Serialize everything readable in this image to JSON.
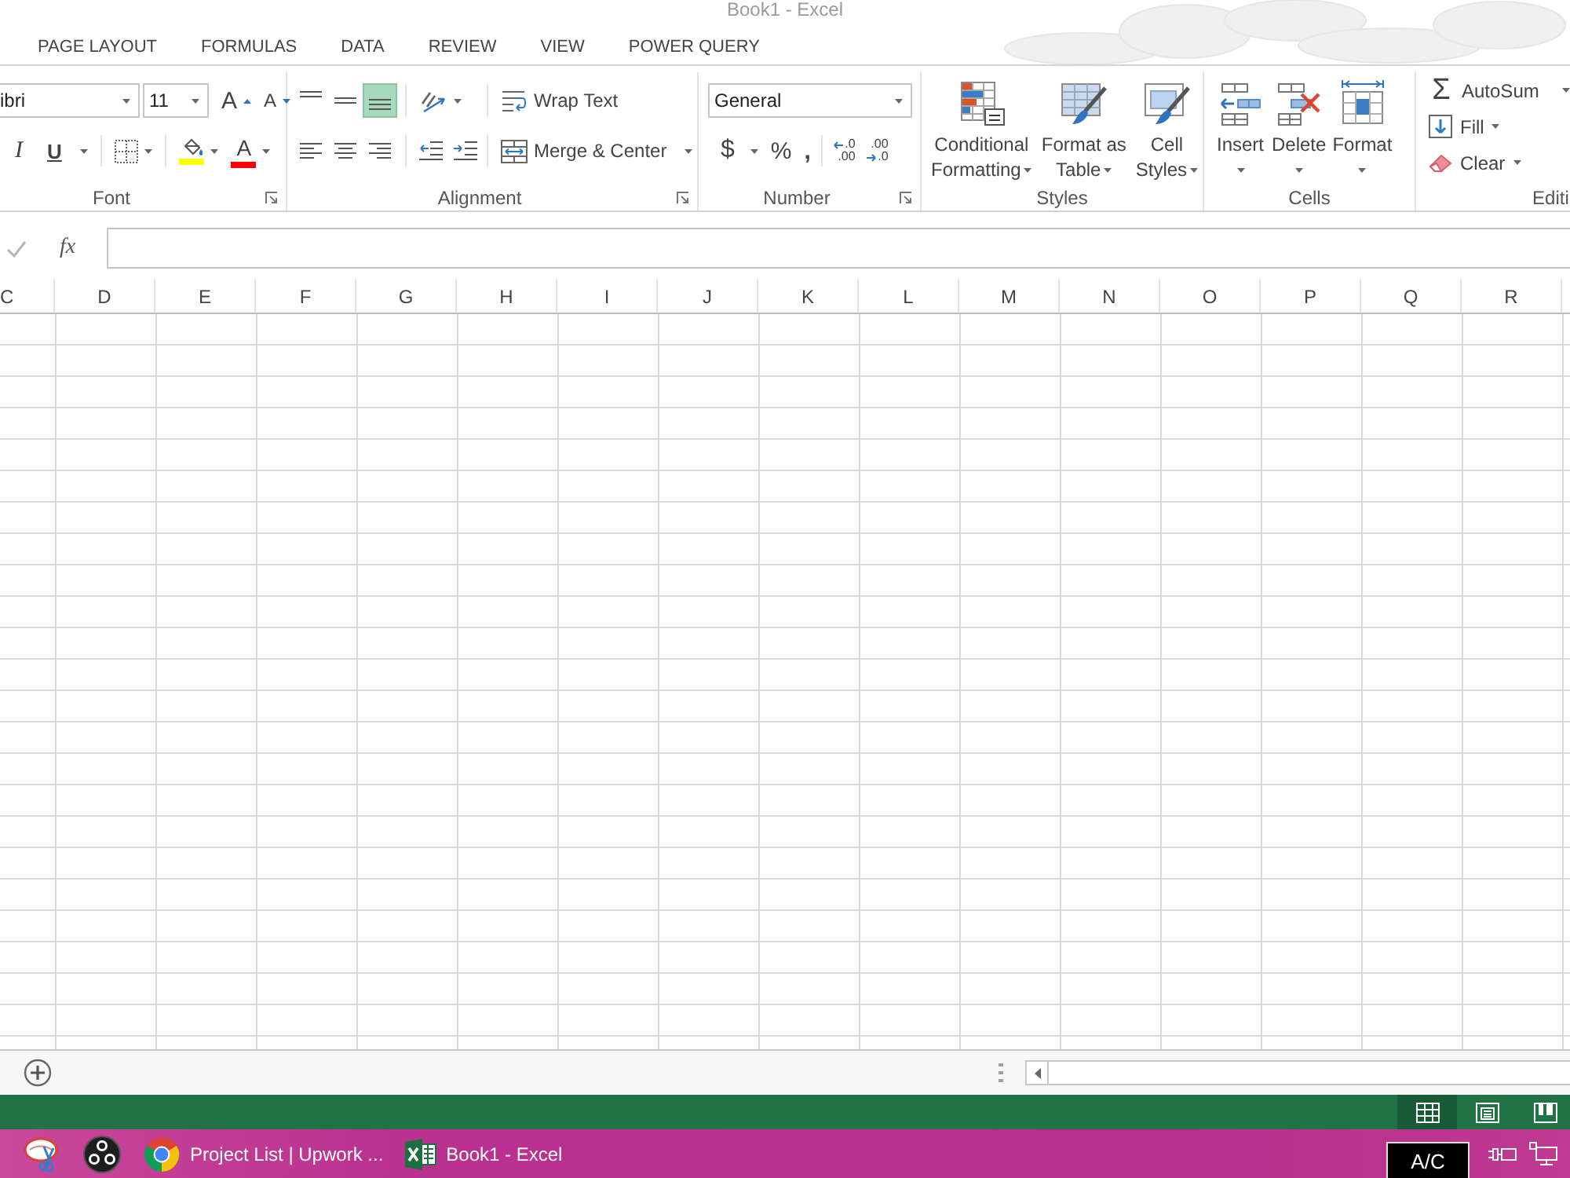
{
  "window": {
    "title": "Book1 - Excel"
  },
  "tabs": [
    {
      "label": "PAGE LAYOUT",
      "selected": false
    },
    {
      "label": "FORMULAS",
      "selected": false
    },
    {
      "label": "DATA",
      "selected": false
    },
    {
      "label": "REVIEW",
      "selected": false
    },
    {
      "label": "VIEW",
      "selected": false
    },
    {
      "label": "POWER QUERY",
      "selected": false
    }
  ],
  "font_group": {
    "label": "Font",
    "font_name": "ibri",
    "font_size": "11",
    "grow_font": "A",
    "shrink_font": "A",
    "italic": "I",
    "underline": "U",
    "font_color": "A"
  },
  "alignment_group": {
    "label": "Alignment",
    "vertical": [
      {
        "kind": "top",
        "selected": false
      },
      {
        "kind": "middle",
        "selected": false
      },
      {
        "kind": "bottom",
        "selected": true
      }
    ],
    "horizontal": [
      {
        "kind": "left",
        "selected": false
      },
      {
        "kind": "center",
        "selected": false
      },
      {
        "kind": "right",
        "selected": false
      }
    ],
    "wrap_text": "Wrap Text",
    "merge": "Merge & Center"
  },
  "number_group": {
    "label": "Number",
    "format": "General",
    "currency": "$",
    "percent": "%",
    "comma": ",",
    "decimals": [
      {
        "kind": "increase",
        "top": ".0",
        "bottom": ".00"
      },
      {
        "kind": "decrease",
        "top": ".00",
        "bottom": ".0"
      }
    ]
  },
  "styles_group": {
    "label": "Styles",
    "buttons": [
      {
        "kind": "conditional",
        "lines": [
          "Conditional",
          "Formatting"
        ]
      },
      {
        "kind": "table",
        "lines": [
          "Format as",
          "Table"
        ]
      },
      {
        "kind": "cell",
        "lines": [
          "Cell",
          "Styles"
        ]
      }
    ]
  },
  "cells_group": {
    "label": "Cells",
    "buttons": [
      {
        "kind": "insert",
        "label": "Insert"
      },
      {
        "kind": "delete",
        "label": "Delete"
      },
      {
        "kind": "format",
        "label": "Format"
      }
    ]
  },
  "editing_group": {
    "label": "Editi",
    "autosum": {
      "symbol": "Σ",
      "label": "AutoSum"
    },
    "fill": "Fill",
    "clear": "Clear"
  },
  "formula_bar": {
    "function_label": "fx"
  },
  "columns": [
    "C",
    "D",
    "E",
    "F",
    "G",
    "H",
    "I",
    "J",
    "K",
    "L",
    "M",
    "N",
    "O",
    "P",
    "Q",
    "R"
  ],
  "views": [
    {
      "kind": "normal",
      "selected": true
    },
    {
      "kind": "page_layout",
      "selected": false
    },
    {
      "kind": "page_break",
      "selected": false
    }
  ],
  "taskbar": {
    "apps": [
      {
        "kind": "snipping"
      },
      {
        "kind": "obs"
      },
      {
        "kind": "browser",
        "label": "Project List | Upwork ..."
      },
      {
        "kind": "excel",
        "label": "Book1 - Excel"
      }
    ],
    "tooltip": "A/C"
  }
}
